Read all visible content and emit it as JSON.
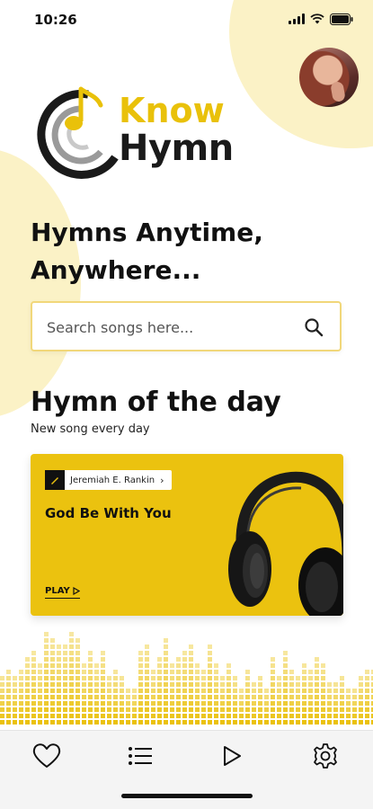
{
  "status_bar": {
    "time": "10:26"
  },
  "logo": {
    "line1": "Know",
    "line2": "Hymn"
  },
  "hero": {
    "heading": "Hymns Anytime, Anywhere..."
  },
  "search": {
    "placeholder": "Search songs here..."
  },
  "hymn_of_day": {
    "title": "Hymn of the day",
    "subtitle": "New song every day",
    "card": {
      "author": "Jeremiah E. Rankin",
      "song": "God Be With You",
      "play_label": "PLAY"
    }
  },
  "tabs": [
    {
      "icon": "heart-icon"
    },
    {
      "icon": "list-icon"
    },
    {
      "icon": "play-icon"
    },
    {
      "icon": "gear-icon"
    }
  ],
  "colors": {
    "accent": "#ebc20f",
    "accent_light": "#fbf2c6",
    "text": "#111111"
  }
}
